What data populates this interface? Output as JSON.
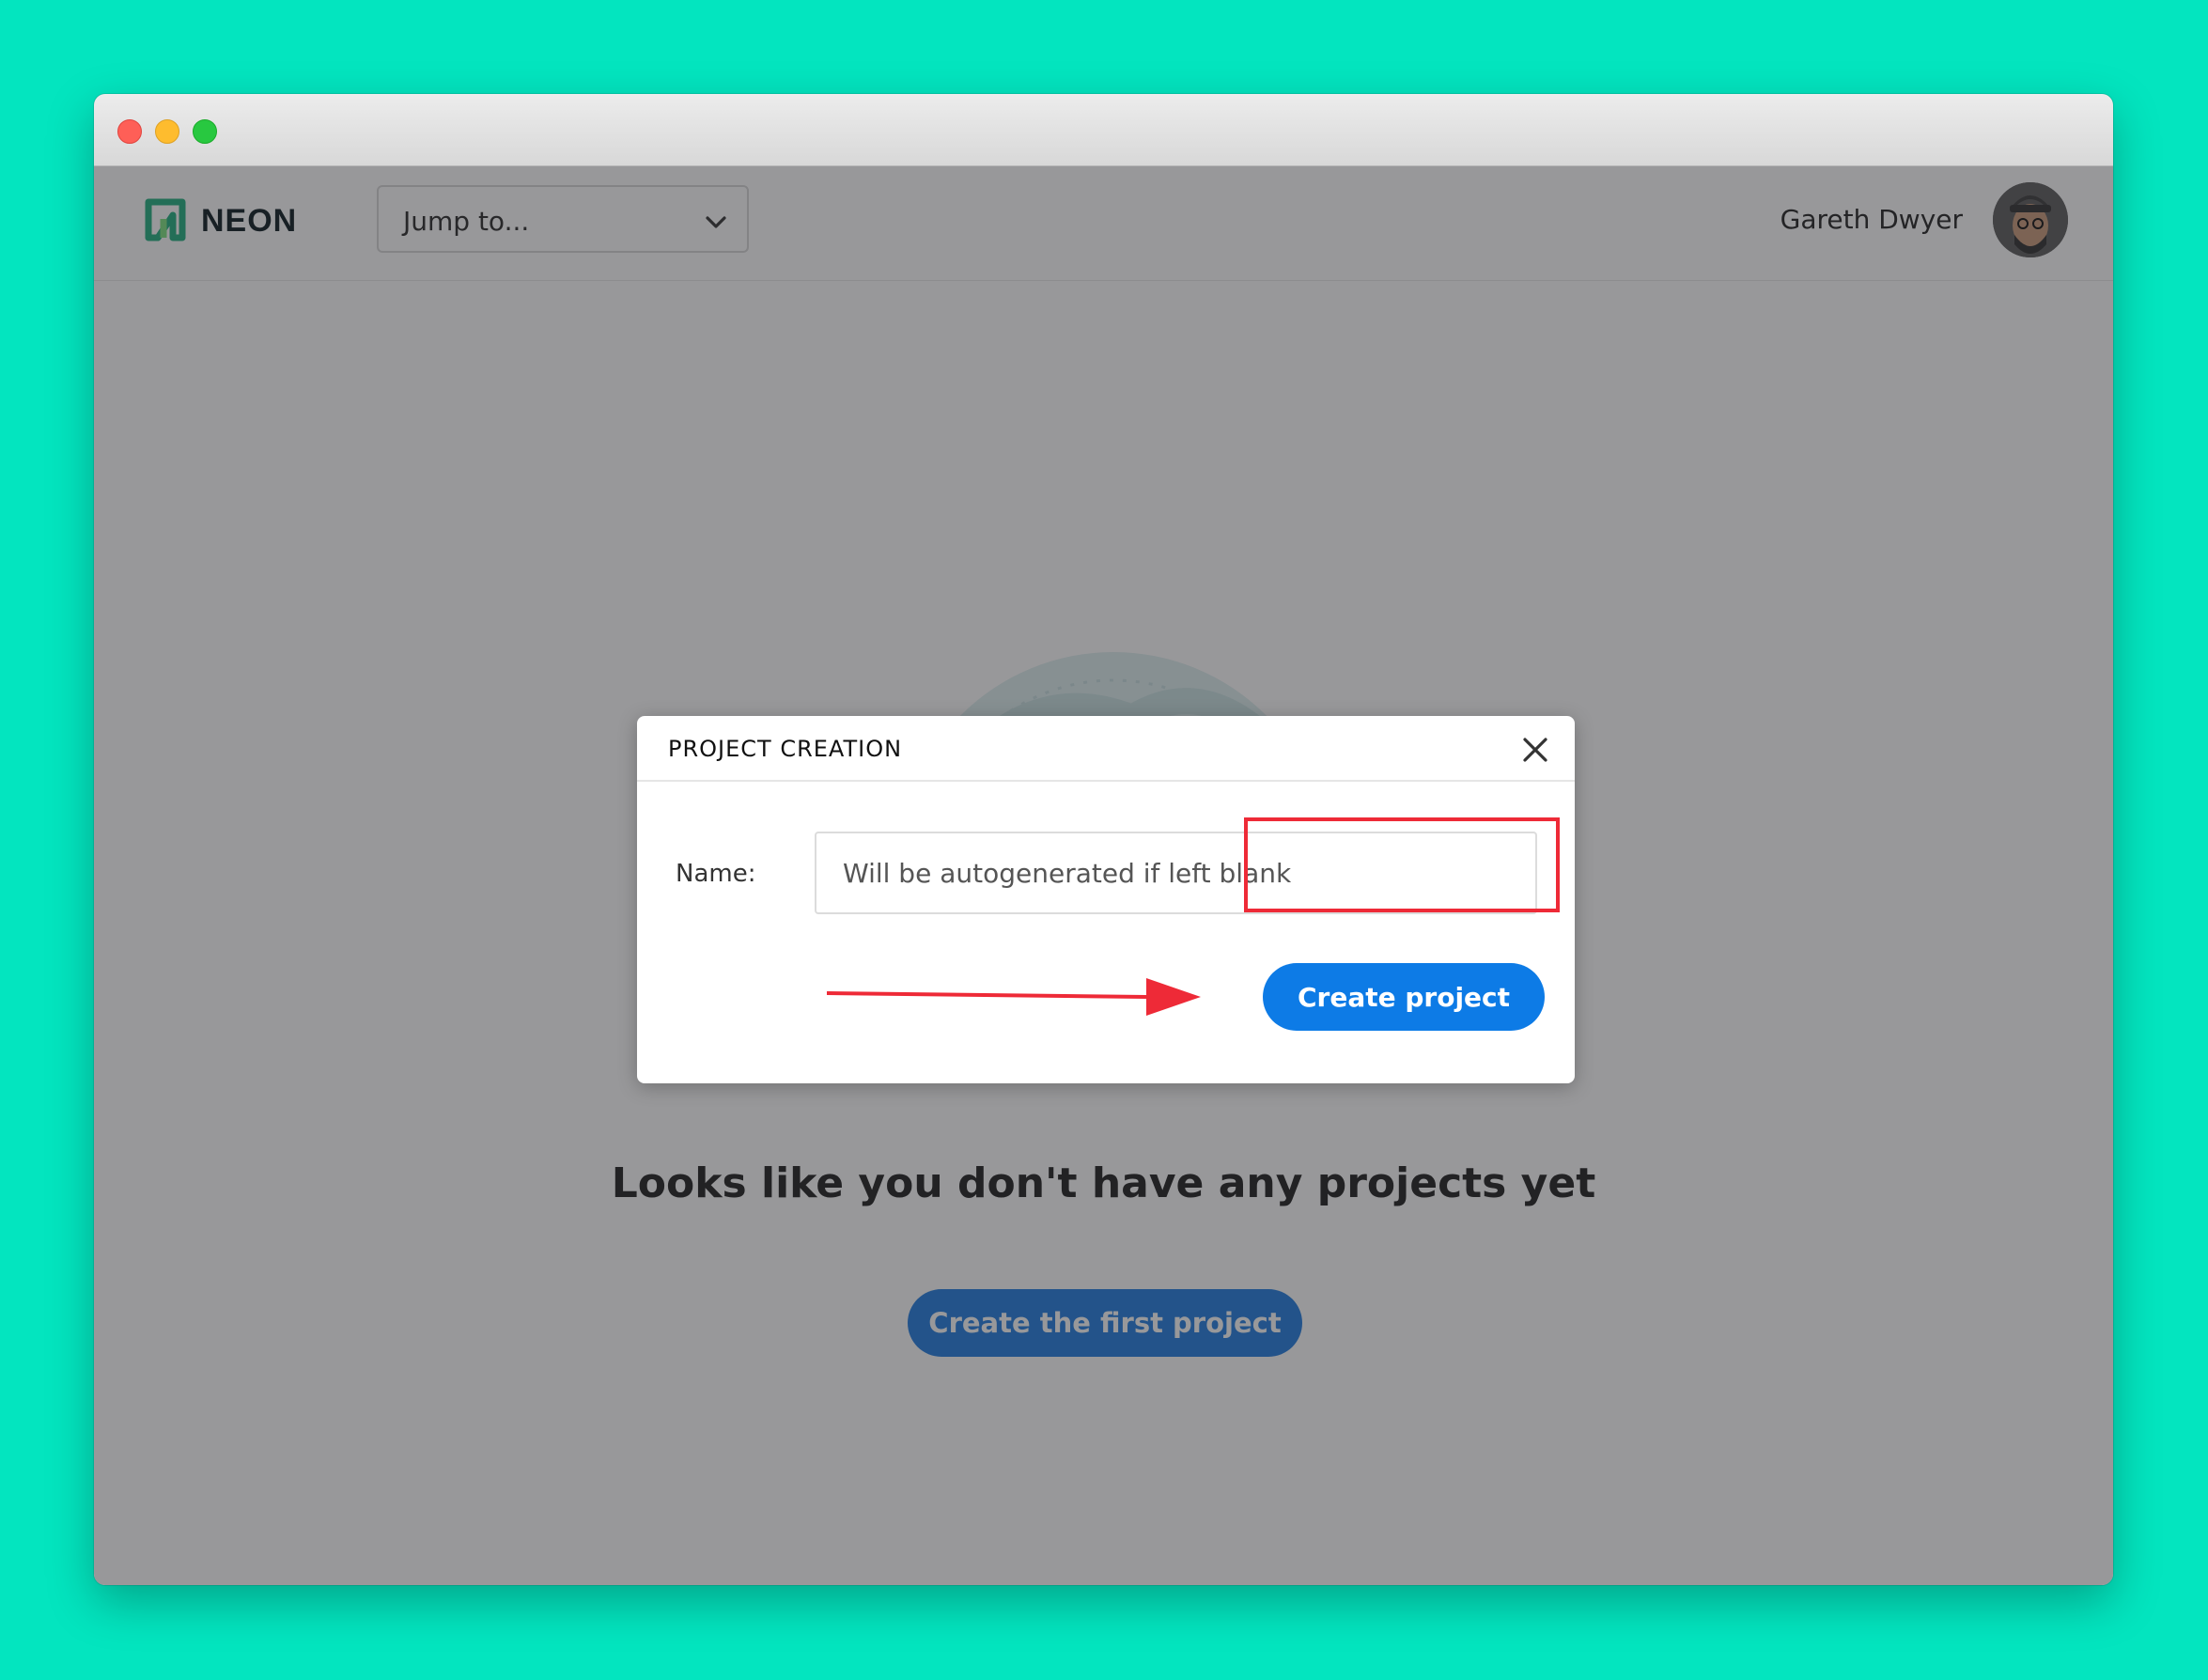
{
  "app": {
    "brand": "NEON",
    "brand_color": "#00e599",
    "jump_label": "Jump to...",
    "user_name": "Gareth Dwyer"
  },
  "empty_state": {
    "heading": "Looks like you don't have any projects yet",
    "button_label": "Create the first project"
  },
  "modal": {
    "title": "PROJECT CREATION",
    "name_label": "Name:",
    "name_placeholder": "Will be autogenerated if left blank",
    "name_value": "",
    "submit_label": "Create project"
  },
  "colors": {
    "background": "#03e5bf",
    "primary_button": "#0d7be6",
    "annotation": "#ee2a37"
  },
  "icons": [
    "chevron-down-icon",
    "close-icon",
    "arrow-annotation"
  ]
}
